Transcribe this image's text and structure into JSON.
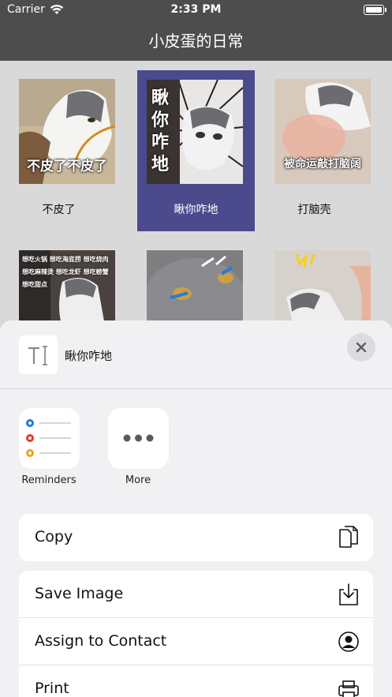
{
  "status": {
    "carrier": "Carrier",
    "time": "2:33 PM"
  },
  "nav": {
    "title": "小皮蛋的日常"
  },
  "grid": {
    "items": [
      {
        "label": "不皮了",
        "caption": "不皮了不皮了",
        "selected": false
      },
      {
        "label": "瞅你咋地",
        "caption": "瞅你咋地",
        "selected": true
      },
      {
        "label": "打脑壳",
        "caption": "被命运敲打脑阔",
        "selected": false
      },
      {
        "label": "",
        "caption": "想吃火锅 想吃海底捞 想吃烧肉 想吃麻辣烫 想吃龙虾 想吃螃蟹 想吃甜点",
        "selected": false
      },
      {
        "label": "",
        "caption": "",
        "selected": false
      },
      {
        "label": "",
        "caption": "",
        "selected": false
      }
    ]
  },
  "sheet": {
    "title": "瞅你咋地",
    "apps": [
      {
        "label": "Reminders",
        "icon": "reminders-icon"
      },
      {
        "label": "More",
        "icon": "more-icon"
      }
    ],
    "actions_primary": [
      {
        "label": "Copy",
        "icon": "copy-icon"
      }
    ],
    "actions_secondary": [
      {
        "label": "Save Image",
        "icon": "save-image-icon"
      },
      {
        "label": "Assign to Contact",
        "icon": "contact-icon"
      },
      {
        "label": "Print",
        "icon": "print-icon"
      }
    ]
  },
  "colors": {
    "nav_bg": "#4d4d4d",
    "selected_bg": "#4b4a8c",
    "sheet_bg": "#f1f1f3"
  }
}
